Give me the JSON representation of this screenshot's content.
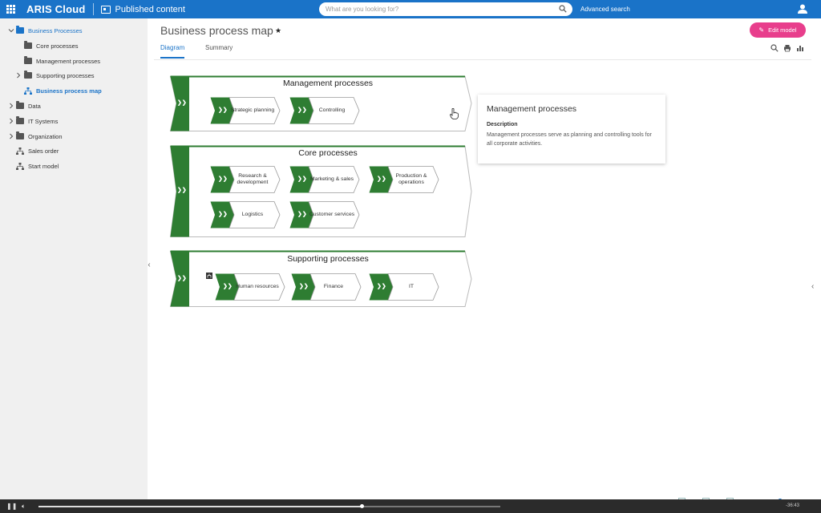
{
  "topbar": {
    "brand": "ARIS Cloud",
    "section": "Published content",
    "search_placeholder": "What are you looking for?",
    "advanced_search": "Advanced search"
  },
  "sidebar": {
    "items": [
      {
        "label": "Business Processes",
        "level": 0,
        "icon": "folder-icon",
        "expanded": true,
        "active": false
      },
      {
        "label": "Core processes",
        "level": 1,
        "icon": "folder-icon"
      },
      {
        "label": "Management processes",
        "level": 1,
        "icon": "folder-icon"
      },
      {
        "label": "Supporting processes",
        "level": 1,
        "icon": "folder-icon",
        "expandable": true
      },
      {
        "label": "Business process map",
        "level": 1,
        "icon": "model-icon",
        "active": true
      },
      {
        "label": "Data",
        "level": 0,
        "icon": "folder-icon",
        "expandable": true
      },
      {
        "label": "IT Systems",
        "level": 0,
        "icon": "folder-icon",
        "expandable": true
      },
      {
        "label": "Organization",
        "level": 0,
        "icon": "folder-icon",
        "expandable": true
      },
      {
        "label": "Sales order",
        "level": 0,
        "icon": "model-icon"
      },
      {
        "label": "Start model",
        "level": 0,
        "icon": "model-icon"
      }
    ]
  },
  "header": {
    "title": "Business process map",
    "edit_button": "Edit model",
    "tabs": [
      {
        "label": "Diagram",
        "active": true
      },
      {
        "label": "Summary",
        "active": false
      }
    ]
  },
  "diagram": {
    "groups": [
      {
        "title": "Management processes",
        "processes": [
          "Strategic planning",
          "Controlling"
        ]
      },
      {
        "title": "Core processes",
        "processes": [
          "Research & development",
          "Marketing & sales",
          "Production & operations",
          "Logistics",
          "Customer services"
        ]
      },
      {
        "title": "Supporting processes",
        "processes": [
          "Human resources",
          "Finance",
          "IT"
        ]
      }
    ]
  },
  "tooltip": {
    "title": "Management processes",
    "description_label": "Description",
    "description": "Management processes serve as planning and controlling tools for all corporate activities."
  },
  "video": {
    "time": "-36:43",
    "progress": 0.7
  },
  "colors": {
    "primary": "#1a73c8",
    "accent": "#e83e8c",
    "process_green": "#2e7d32"
  }
}
